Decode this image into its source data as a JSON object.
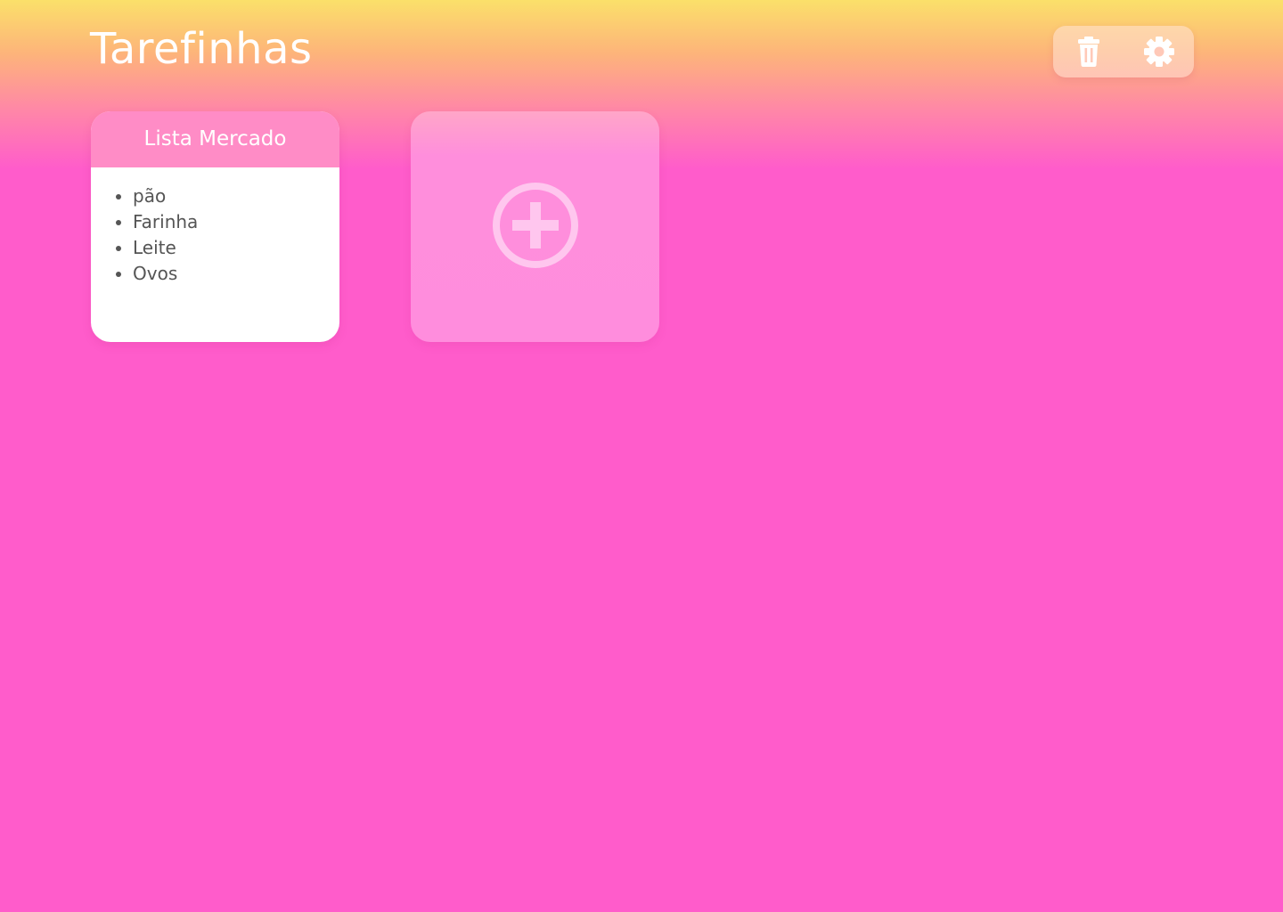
{
  "app": {
    "title": "Tarefinhas"
  },
  "toolbar": {
    "buttons": [
      {
        "name": "delete",
        "icon": "trash-icon"
      },
      {
        "name": "settings",
        "icon": "gear-icon"
      }
    ]
  },
  "notes": [
    {
      "title": "Lista Mercado",
      "items": [
        "pão",
        "Farinha",
        "Leite",
        "Ovos"
      ]
    }
  ],
  "add_card": {
    "icon": "plus-circle-icon"
  },
  "colors": {
    "background_top": "#fbe06a",
    "background_main": "#ff5ccb",
    "note_header": "#ff8cc6",
    "note_text": "#555555",
    "add_card": "#ff8ddd"
  }
}
